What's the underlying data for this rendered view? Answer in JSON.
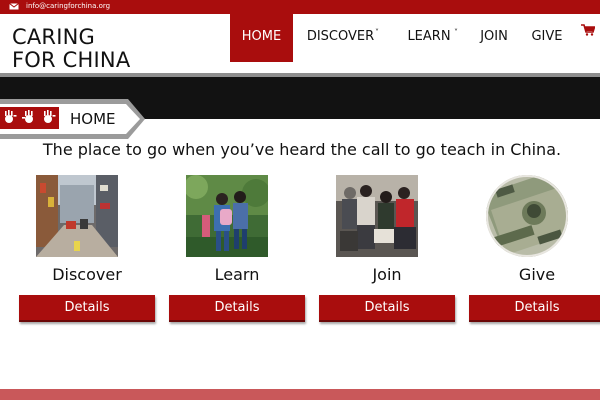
{
  "topbar": {
    "email": "info@caringforchina.org",
    "mail_icon": "envelope-icon"
  },
  "logo": {
    "line1": "CARING",
    "line2": "FOR CHINA"
  },
  "nav": {
    "items": [
      {
        "label": "HOME",
        "active": true
      },
      {
        "label": "DISCOVER",
        "dropdown": true
      },
      {
        "label": "LEARN",
        "dropdown": true
      },
      {
        "label": "JOIN"
      },
      {
        "label": "GIVE"
      }
    ],
    "caret": "˅",
    "cart_icon": "shopping-cart-icon"
  },
  "breadcrumb": {
    "label": "HOME",
    "logo_icon": "handprints-logo-icon"
  },
  "tagline": "The place to go when you’ve heard the call to go teach in China.",
  "cards": [
    {
      "title": "Discover",
      "button": "Details",
      "image": "city-street-photo"
    },
    {
      "title": "Learn",
      "button": "Details",
      "image": "students-walking-photo"
    },
    {
      "title": "Join",
      "button": "Details",
      "image": "group-meeting-photo"
    },
    {
      "title": "Give",
      "button": "Details",
      "image": "dollar-bills-photo"
    }
  ],
  "colors": {
    "brand_red": "#a90d0d",
    "dark_band": "#121212",
    "footer_band": "#c9585a"
  }
}
